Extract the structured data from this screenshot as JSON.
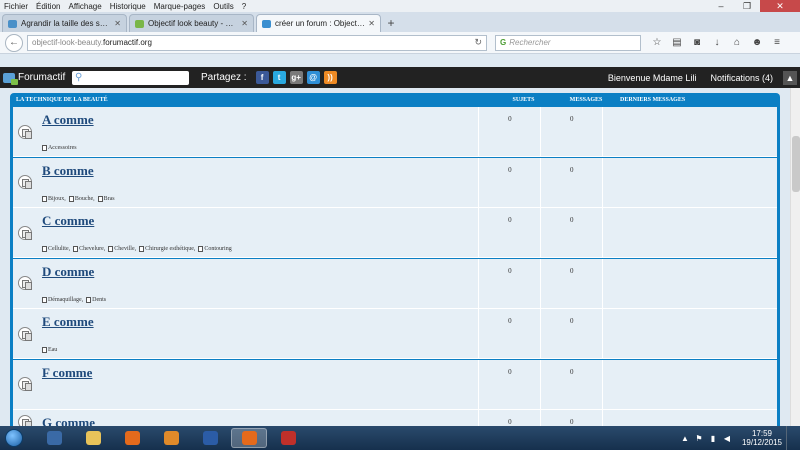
{
  "menubar": [
    "Fichier",
    "Édition",
    "Affichage",
    "Historique",
    "Marque-pages",
    "Outils",
    "?"
  ],
  "tabs": [
    {
      "label": "Agrandir la taille des sous f...",
      "active": false,
      "icon_color": "#4a90c8"
    },
    {
      "label": "Objectif look beauty - Bien...",
      "active": false,
      "icon_color": "#7ab648"
    },
    {
      "label": "créer un forum : Objectif b...",
      "active": true,
      "icon_color": "#3a8fd0"
    }
  ],
  "nav": {
    "url_prefix": "objectif-look-beauty.",
    "url_domain": "forumactif.org",
    "search_placeholder": "Rechercher"
  },
  "toolbar": {
    "brand": "Forumactif",
    "share_label": "Partagez :",
    "share_buttons": [
      {
        "name": "facebook",
        "glyph": "f",
        "color": "#3b5998"
      },
      {
        "name": "twitter",
        "glyph": "t",
        "color": "#2aa9e0"
      },
      {
        "name": "googleplus",
        "glyph": "g+",
        "color": "#7a7a7a"
      },
      {
        "name": "email",
        "glyph": "@",
        "color": "#2f8fd6"
      },
      {
        "name": "rss",
        "glyph": "))",
        "color": "#ee8a24"
      }
    ],
    "welcome": "Bienvenue Mdame Lili",
    "notifications": "Notifications",
    "notif_count": "(4)"
  },
  "forum": {
    "category": "LA TECHNIQUE DE LA BEAUTÉ",
    "col_topics": "SUJETS",
    "col_messages": "MESSAGES",
    "col_last": "DERNIERS MESSAGES",
    "rows": [
      {
        "title": "A comme",
        "topics": "0",
        "messages": "0",
        "subs": [
          "Accessoires"
        ]
      },
      {
        "title": "B comme",
        "topics": "0",
        "messages": "0",
        "subs": [
          "Bijoux,",
          "Bouche,",
          "Bras"
        ]
      },
      {
        "title": "C comme",
        "topics": "0",
        "messages": "0",
        "subs": [
          "Cellulite,",
          "Chevelure,",
          "Cheville,",
          "Chirurgie esthétique,",
          "Contouring"
        ]
      },
      {
        "title": "D comme",
        "topics": "0",
        "messages": "0",
        "subs": [
          "Démaquillage,",
          "Dents"
        ]
      },
      {
        "title": "E comme",
        "topics": "0",
        "messages": "0",
        "subs": [
          "Eau"
        ]
      },
      {
        "title": "F comme",
        "topics": "0",
        "messages": "0",
        "subs": []
      },
      {
        "title": "G comme",
        "topics": "0",
        "messages": "0",
        "subs": []
      }
    ]
  },
  "taskbar": {
    "apps": [
      {
        "name": "control-panel",
        "color": "#3a6aa6",
        "active": false
      },
      {
        "name": "explorer",
        "color": "#e8c35a",
        "active": false
      },
      {
        "name": "firefox",
        "color": "#e46a1c",
        "active": false
      },
      {
        "name": "mail",
        "color": "#e08a2a",
        "active": false
      },
      {
        "name": "word",
        "color": "#2b5ca6",
        "active": false
      },
      {
        "name": "firefox-active",
        "color": "#e46a1c",
        "active": true
      },
      {
        "name": "pdf",
        "color": "#c0302a",
        "active": false
      }
    ],
    "time": "17:59",
    "date": "19/12/2015"
  }
}
